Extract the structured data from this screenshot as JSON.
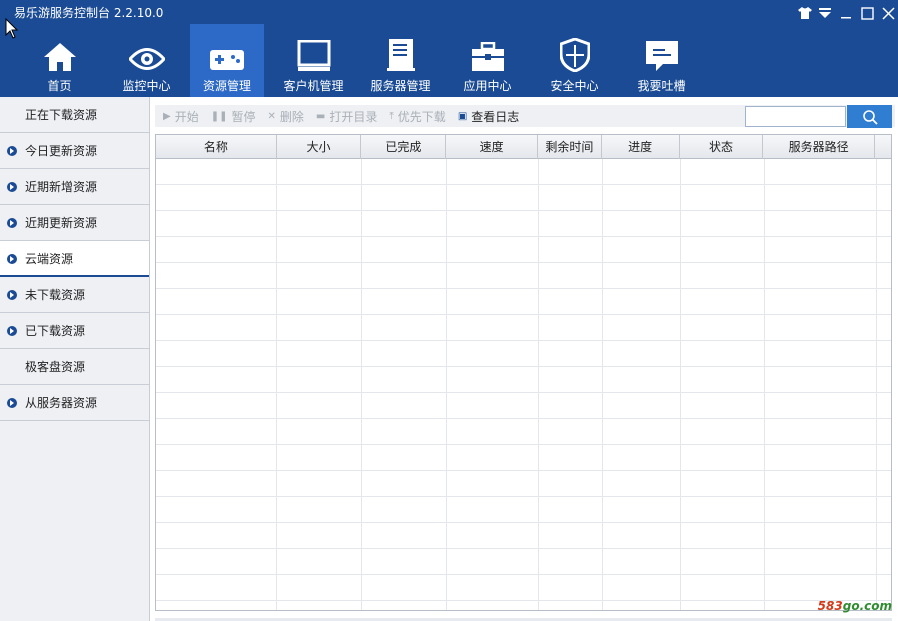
{
  "window": {
    "title": "易乐游服务控制台 2.2.10.0"
  },
  "nav": {
    "items": [
      {
        "label": "首页",
        "icon": "home-icon"
      },
      {
        "label": "监控中心",
        "icon": "eye-icon"
      },
      {
        "label": "资源管理",
        "icon": "gamepad-icon",
        "active": true
      },
      {
        "label": "客户机管理",
        "icon": "monitor-icon"
      },
      {
        "label": "服务器管理",
        "icon": "server-icon"
      },
      {
        "label": "应用中心",
        "icon": "toolbox-icon"
      },
      {
        "label": "安全中心",
        "icon": "shield-icon"
      },
      {
        "label": "我要吐槽",
        "icon": "chat-bubble-icon"
      }
    ]
  },
  "sidebar": {
    "items": [
      {
        "label": "正在下载资源",
        "dot": false
      },
      {
        "label": "今日更新资源",
        "dot": true
      },
      {
        "label": "近期新增资源",
        "dot": true
      },
      {
        "label": "近期更新资源",
        "dot": true
      },
      {
        "label": "云端资源",
        "dot": true,
        "active": true
      },
      {
        "label": "未下载资源",
        "dot": true
      },
      {
        "label": "已下载资源",
        "dot": true
      },
      {
        "label": "极客盘资源",
        "dot": false
      },
      {
        "label": "从服务器资源",
        "dot": true
      }
    ]
  },
  "toolbar": {
    "start": "开始",
    "pause": "暂停",
    "delete": "删除",
    "open_dir": "打开目录",
    "priority": "优先下载",
    "view_log": "查看日志"
  },
  "search": {
    "placeholder": ""
  },
  "table": {
    "columns": [
      "名称",
      "大小",
      "已完成",
      "速度",
      "剩余时间",
      "进度",
      "状态",
      "服务器路径"
    ]
  },
  "watermark": {
    "prefix": "583",
    "suffix": "go.com"
  },
  "colors": {
    "header": "#1a4b94",
    "nav_active": "#2d6ac8",
    "search_button": "#2f7ed2"
  }
}
